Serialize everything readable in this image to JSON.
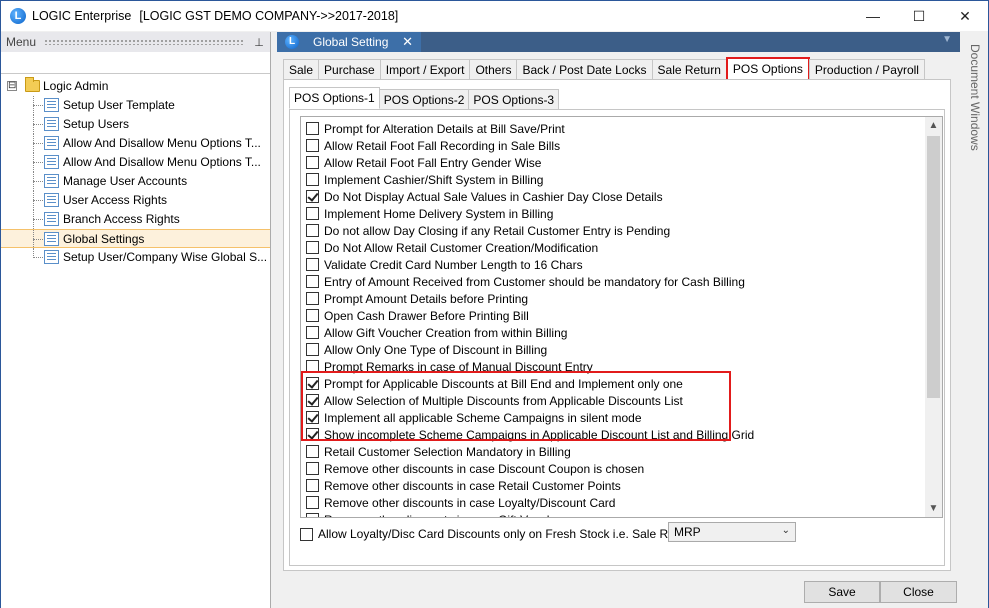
{
  "window": {
    "app_name": "LOGIC Enterprise",
    "title_context": "[LOGIC GST DEMO COMPANY->>2017-2018]",
    "minimize": "—",
    "maximize": "☐",
    "close": "✕"
  },
  "menu_panel": {
    "header": "Menu",
    "pin": "⊥",
    "root": {
      "expander": "⊟",
      "label": "Logic Admin"
    },
    "items": [
      {
        "label": "Setup User Template"
      },
      {
        "label": "Setup Users"
      },
      {
        "label": "Allow And Disallow Menu Options T..."
      },
      {
        "label": "Allow And Disallow Menu Options T..."
      },
      {
        "label": "Manage User Accounts"
      },
      {
        "label": "User Access Rights"
      },
      {
        "label": "Branch Access Rights"
      },
      {
        "label": "Global Settings"
      },
      {
        "label": "Setup User/Company Wise Global S..."
      }
    ],
    "selected_index": 7
  },
  "document_tab": {
    "label": "Global Setting",
    "close": "✕",
    "icon_letter": "L"
  },
  "document_windows_label": "Document Windows",
  "tabs": [
    "Sale",
    "Purchase",
    "Import / Export",
    "Others",
    "Back / Post Date Locks",
    "Sale Return",
    "POS Options",
    "Production  / Payroll"
  ],
  "active_tab": "POS Options",
  "subtabs": [
    "POS Options-1",
    "POS Options-2",
    "POS Options-3"
  ],
  "active_subtab": "POS Options-1",
  "options": [
    {
      "label": "Prompt for Alteration Details at Bill Save/Print",
      "checked": false
    },
    {
      "label": "Allow Retail Foot Fall Recording in Sale Bills",
      "checked": false
    },
    {
      "label": "Allow Retail Foot Fall Entry Gender Wise",
      "checked": false
    },
    {
      "label": "Implement Cashier/Shift System in Billing",
      "checked": false
    },
    {
      "label": "Do Not Display Actual Sale Values in Cashier Day Close Details",
      "checked": true
    },
    {
      "label": "Implement Home Delivery System in Billing",
      "checked": false
    },
    {
      "label": "Do not allow Day Closing if any Retail Customer Entry is Pending",
      "checked": false
    },
    {
      "label": "Do Not Allow Retail Customer Creation/Modification",
      "checked": false
    },
    {
      "label": "Validate Credit Card Number Length to 16 Chars",
      "checked": false
    },
    {
      "label": "Entry of Amount Received from Customer should be mandatory for Cash Billing",
      "checked": false
    },
    {
      "label": "Prompt Amount Details before Printing",
      "checked": false
    },
    {
      "label": "Open Cash Drawer Before Printing Bill",
      "checked": false
    },
    {
      "label": "Allow Gift Voucher Creation from within Billing",
      "checked": false
    },
    {
      "label": "Allow Only One Type of Discount in Billing",
      "checked": false
    },
    {
      "label": "Prompt Remarks in case of Manual Discount Entry",
      "checked": false
    },
    {
      "label": "Prompt for Applicable Discounts at Bill End and Implement only one",
      "checked": true
    },
    {
      "label": "Allow Selection of Multiple Discounts from Applicable Discounts List",
      "checked": true
    },
    {
      "label": "Implement all applicable Scheme Campaigns in silent mode",
      "checked": true
    },
    {
      "label": "Show incomplete Scheme Campaigns in Applicable Discount List and Billing Grid",
      "checked": true
    },
    {
      "label": "Retail Customer Selection Mandatory in Billing",
      "checked": false
    },
    {
      "label": "Remove other discounts in case Discount Coupon is chosen",
      "checked": false
    },
    {
      "label": "Remove other discounts in case Retail Customer Points",
      "checked": false
    },
    {
      "label": "Remove other discounts in case Loyalty/Discount Card",
      "checked": false
    },
    {
      "label": "Remove other discounts in case Gift Vouchers",
      "checked": false
    }
  ],
  "scroll": {
    "up": "▲",
    "down": "▼"
  },
  "bottom_option": {
    "label": "Allow Loyalty/Disc Card Discounts only on Fresh Stock i.e. Sale Rate=",
    "checked": false
  },
  "sale_rate_select": {
    "value": "MRP",
    "chevron": "⌄"
  },
  "buttons": {
    "save": "Save",
    "close": "Close"
  },
  "colors": {
    "highlight": "#e21b1b",
    "doc_tab": "#3d6fa8",
    "selected_row": "#fdf1dc"
  }
}
